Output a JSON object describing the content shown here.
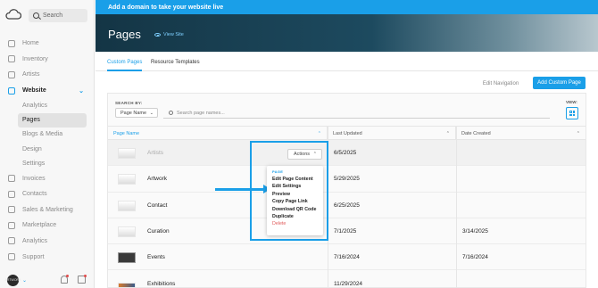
{
  "sidebar": {
    "search_placeholder": "Search",
    "items": [
      {
        "label": "Home",
        "icon": "home-icon"
      },
      {
        "label": "Inventory",
        "icon": "inventory-icon"
      },
      {
        "label": "Artists",
        "icon": "brush-icon"
      },
      {
        "label": "Website",
        "icon": "website-icon",
        "active": true
      }
    ],
    "website_sub": [
      {
        "label": "Analytics"
      },
      {
        "label": "Pages",
        "active": true
      },
      {
        "label": "Blogs & Media"
      },
      {
        "label": "Design"
      },
      {
        "label": "Settings"
      }
    ],
    "items_after": [
      {
        "label": "Invoices",
        "icon": "invoice-icon"
      },
      {
        "label": "Contacts",
        "icon": "contacts-icon"
      },
      {
        "label": "Sales & Marketing",
        "icon": "megaphone-icon"
      },
      {
        "label": "Marketplace",
        "icon": "marketplace-icon"
      },
      {
        "label": "Analytics",
        "icon": "chart-icon"
      },
      {
        "label": "Support",
        "icon": "support-icon"
      }
    ],
    "avatar_text": "ARTWORK"
  },
  "banner": {
    "text": "Add a domain to take your website live"
  },
  "hero": {
    "title": "Pages",
    "view_site": "View Site"
  },
  "tabs": [
    {
      "label": "Custom Pages",
      "active": true
    },
    {
      "label": "Resource Templates",
      "active": false
    }
  ],
  "toolbar": {
    "edit_navigation": "Edit Navigation",
    "add_custom_page": "Add Custom Page"
  },
  "filters": {
    "search_by_label": "SEARCH BY:",
    "search_by_value": "Page Name",
    "search_placeholder": "Search page names...",
    "view_label": "VIEW:"
  },
  "table": {
    "columns": [
      "Page Name",
      "Last Updated",
      "Date Created"
    ],
    "rows": [
      {
        "name": "Artists",
        "last_updated": "6/5/2025",
        "date_created": "",
        "thumb": "light"
      },
      {
        "name": "Artwork",
        "last_updated": "5/29/2025",
        "date_created": "",
        "thumb": "light"
      },
      {
        "name": "Contact",
        "last_updated": "6/25/2025",
        "date_created": "",
        "thumb": "light"
      },
      {
        "name": "Curation",
        "last_updated": "7/1/2025",
        "date_created": "3/14/2025",
        "thumb": "light"
      },
      {
        "name": "Events",
        "last_updated": "7/16/2024",
        "date_created": "7/16/2024",
        "thumb": "dark"
      },
      {
        "name": "Exhibitions",
        "last_updated": "11/29/2024",
        "date_created": "",
        "thumb": "orange"
      }
    ]
  },
  "actions": {
    "button_label": "Actions",
    "menu_header": "PAGE",
    "menu_items": [
      "Edit Page Content",
      "Edit Settings",
      "Preview",
      "Copy Page Link",
      "Download QR Code",
      "Duplicate",
      "Delete"
    ]
  },
  "colors": {
    "accent": "#1a9fe8",
    "danger": "#e05a5a"
  }
}
